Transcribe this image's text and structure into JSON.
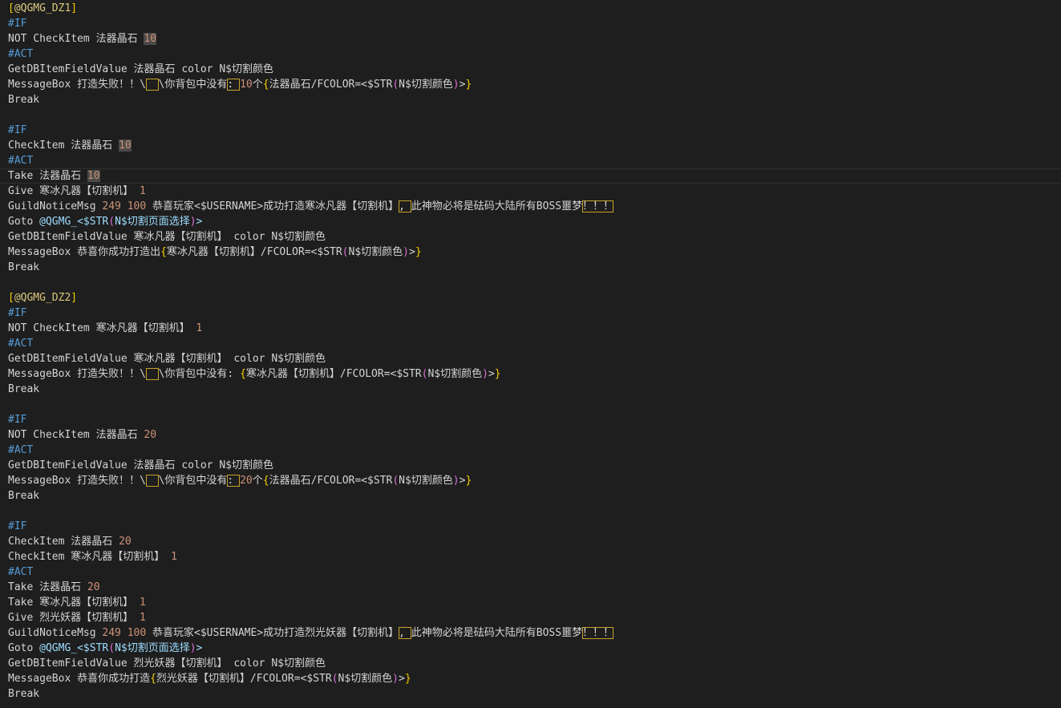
{
  "theme": {
    "background": "#1e1e1e",
    "colors": {
      "default": "#d4d4d4",
      "section": "#dcc97b",
      "bracket": "#f5d000",
      "keyword": "#569cd6",
      "number": "#ce9178",
      "paren": "#da70d6",
      "variable": "#9cdcfe",
      "link": "#9cdcfe"
    }
  },
  "lines": [
    [
      {
        "t": "[",
        "c": "bracket"
      },
      {
        "t": "@QGMG_DZ1",
        "c": "section"
      },
      {
        "t": "]",
        "c": "bracket"
      }
    ],
    [
      {
        "t": "#IF",
        "c": "keyword"
      }
    ],
    [
      {
        "t": "NOT CheckItem 法器晶石 ",
        "c": "default"
      },
      {
        "t": "10",
        "c": "number",
        "hl": true
      }
    ],
    [
      {
        "t": "#ACT",
        "c": "keyword"
      }
    ],
    [
      {
        "t": "GetDBItemFieldValue 法器晶石 color N$切割颜色",
        "c": "default"
      }
    ],
    [
      {
        "t": "MessageBox 打造失败！！\\",
        "c": "default"
      },
      {
        "t": "  ",
        "c": "default",
        "box": true
      },
      {
        "t": "\\你背包中没有",
        "c": "default"
      },
      {
        "t": ": ",
        "c": "default",
        "box": true
      },
      {
        "t": "10",
        "c": "number"
      },
      {
        "t": "个",
        "c": "default"
      },
      {
        "t": "{",
        "c": "bracket"
      },
      {
        "t": "法器晶石/FCOLOR=<$STR",
        "c": "default"
      },
      {
        "t": "(",
        "c": "paren"
      },
      {
        "t": "N$切割颜色",
        "c": "default"
      },
      {
        "t": ")",
        "c": "paren"
      },
      {
        "t": ">",
        "c": "default"
      },
      {
        "t": "}",
        "c": "bracket"
      }
    ],
    [
      {
        "t": "Break",
        "c": "default"
      }
    ],
    [],
    [
      {
        "t": "#IF",
        "c": "keyword"
      }
    ],
    [
      {
        "t": "CheckItem 法器晶石 ",
        "c": "default"
      },
      {
        "t": "10",
        "c": "number",
        "hl": true
      }
    ],
    [
      {
        "t": "#ACT",
        "c": "keyword"
      }
    ],
    [
      {
        "t": "Take 法器晶石 ",
        "c": "default"
      },
      {
        "t": "10",
        "c": "number",
        "hl": true
      }
    ],
    [
      {
        "t": "Give 寒冰凡器【切割机】 ",
        "c": "default"
      },
      {
        "t": "1",
        "c": "number"
      }
    ],
    [
      {
        "t": "GuildNoticeMsg ",
        "c": "default"
      },
      {
        "t": "249 100",
        "c": "number"
      },
      {
        "t": " 恭喜玩家<$USERNAME>成功打造寒冰凡器【切割机】",
        "c": "default"
      },
      {
        "t": ", ",
        "c": "default",
        "box": true
      },
      {
        "t": "此神物必将是砝码大陆所有BOSS噩梦",
        "c": "default"
      },
      {
        "t": "！！！",
        "c": "default",
        "box": true
      }
    ],
    [
      {
        "t": "Goto ",
        "c": "default"
      },
      {
        "t": "@QGMG_<$STR",
        "c": "link"
      },
      {
        "t": "(",
        "c": "paren"
      },
      {
        "t": "N$切割页面选择",
        "c": "link"
      },
      {
        "t": ")",
        "c": "paren"
      },
      {
        "t": ">",
        "c": "link"
      }
    ],
    [
      {
        "t": "GetDBItemFieldValue 寒冰凡器【切割机】 color N$切割颜色",
        "c": "default"
      }
    ],
    [
      {
        "t": "MessageBox 恭喜你成功打造出",
        "c": "default"
      },
      {
        "t": "{",
        "c": "bracket"
      },
      {
        "t": "寒冰凡器【切割机】/FCOLOR=<$STR",
        "c": "default"
      },
      {
        "t": "(",
        "c": "paren"
      },
      {
        "t": "N$切割颜色",
        "c": "default"
      },
      {
        "t": ")",
        "c": "paren"
      },
      {
        "t": ">",
        "c": "default"
      },
      {
        "t": "}",
        "c": "bracket"
      }
    ],
    [
      {
        "t": "Break",
        "c": "default"
      }
    ],
    [],
    [
      {
        "t": "[",
        "c": "bracket"
      },
      {
        "t": "@QGMG_DZ2",
        "c": "section"
      },
      {
        "t": "]",
        "c": "bracket"
      }
    ],
    [
      {
        "t": "#IF",
        "c": "keyword"
      }
    ],
    [
      {
        "t": "NOT CheckItem 寒冰凡器【切割机】 ",
        "c": "default"
      },
      {
        "t": "1",
        "c": "number"
      }
    ],
    [
      {
        "t": "#ACT",
        "c": "keyword"
      }
    ],
    [
      {
        "t": "GetDBItemFieldValue 寒冰凡器【切割机】 color N$切割颜色",
        "c": "default"
      }
    ],
    [
      {
        "t": "MessageBox 打造失败！！\\",
        "c": "default"
      },
      {
        "t": "  ",
        "c": "default",
        "box": true
      },
      {
        "t": "\\你背包中没有: ",
        "c": "default"
      },
      {
        "t": "{",
        "c": "bracket"
      },
      {
        "t": "寒冰凡器【切割机】/FCOLOR=<$STR",
        "c": "default"
      },
      {
        "t": "(",
        "c": "paren"
      },
      {
        "t": "N$切割颜色",
        "c": "default"
      },
      {
        "t": ")",
        "c": "paren"
      },
      {
        "t": ">",
        "c": "default"
      },
      {
        "t": "}",
        "c": "bracket"
      }
    ],
    [
      {
        "t": "Break",
        "c": "default"
      }
    ],
    [],
    [
      {
        "t": "#IF",
        "c": "keyword"
      }
    ],
    [
      {
        "t": "NOT CheckItem 法器晶石 ",
        "c": "default"
      },
      {
        "t": "20",
        "c": "number"
      }
    ],
    [
      {
        "t": "#ACT",
        "c": "keyword"
      }
    ],
    [
      {
        "t": "GetDBItemFieldValue 法器晶石 color N$切割颜色",
        "c": "default"
      }
    ],
    [
      {
        "t": "MessageBox 打造失败！！\\",
        "c": "default"
      },
      {
        "t": "  ",
        "c": "default",
        "box": true
      },
      {
        "t": "\\你背包中没有",
        "c": "default"
      },
      {
        "t": ": ",
        "c": "default",
        "box": true
      },
      {
        "t": "20",
        "c": "number"
      },
      {
        "t": "个",
        "c": "default"
      },
      {
        "t": "{",
        "c": "bracket"
      },
      {
        "t": "法器晶石/FCOLOR=<$STR",
        "c": "default"
      },
      {
        "t": "(",
        "c": "paren"
      },
      {
        "t": "N$切割颜色",
        "c": "default"
      },
      {
        "t": ")",
        "c": "paren"
      },
      {
        "t": ">",
        "c": "default"
      },
      {
        "t": "}",
        "c": "bracket"
      }
    ],
    [
      {
        "t": "Break",
        "c": "default"
      }
    ],
    [],
    [
      {
        "t": "#IF",
        "c": "keyword"
      }
    ],
    [
      {
        "t": "CheckItem 法器晶石 ",
        "c": "default"
      },
      {
        "t": "20",
        "c": "number"
      }
    ],
    [
      {
        "t": "CheckItem 寒冰凡器【切割机】 ",
        "c": "default"
      },
      {
        "t": "1",
        "c": "number"
      }
    ],
    [
      {
        "t": "#ACT",
        "c": "keyword"
      }
    ],
    [
      {
        "t": "Take 法器晶石 ",
        "c": "default"
      },
      {
        "t": "20",
        "c": "number"
      }
    ],
    [
      {
        "t": "Take 寒冰凡器【切割机】 ",
        "c": "default"
      },
      {
        "t": "1",
        "c": "number"
      }
    ],
    [
      {
        "t": "Give 烈光妖器【切割机】 ",
        "c": "default"
      },
      {
        "t": "1",
        "c": "number"
      }
    ],
    [
      {
        "t": "GuildNoticeMsg ",
        "c": "default"
      },
      {
        "t": "249 100",
        "c": "number"
      },
      {
        "t": " 恭喜玩家<$USERNAME>成功打造烈光妖器【切割机】",
        "c": "default"
      },
      {
        "t": ", ",
        "c": "default",
        "box": true
      },
      {
        "t": "此神物必将是砝码大陆所有BOSS噩梦",
        "c": "default"
      },
      {
        "t": "！！！",
        "c": "default",
        "box": true
      }
    ],
    [
      {
        "t": "Goto ",
        "c": "default"
      },
      {
        "t": "@QGMG_<$STR",
        "c": "link"
      },
      {
        "t": "(",
        "c": "paren"
      },
      {
        "t": "N$切割页面选择",
        "c": "link"
      },
      {
        "t": ")",
        "c": "paren"
      },
      {
        "t": ">",
        "c": "link"
      }
    ],
    [
      {
        "t": "GetDBItemFieldValue 烈光妖器【切割机】 color N$切割颜色",
        "c": "default"
      }
    ],
    [
      {
        "t": "MessageBox 恭喜你成功打造",
        "c": "default"
      },
      {
        "t": "{",
        "c": "bracket"
      },
      {
        "t": "烈光妖器【切割机】/FCOLOR=<$STR",
        "c": "default"
      },
      {
        "t": "(",
        "c": "paren"
      },
      {
        "t": "N$切割颜色",
        "c": "default"
      },
      {
        "t": ")",
        "c": "paren"
      },
      {
        "t": ">",
        "c": "default"
      },
      {
        "t": "}",
        "c": "bracket"
      }
    ],
    [
      {
        "t": "Break",
        "c": "default"
      }
    ]
  ],
  "current_line": 11
}
